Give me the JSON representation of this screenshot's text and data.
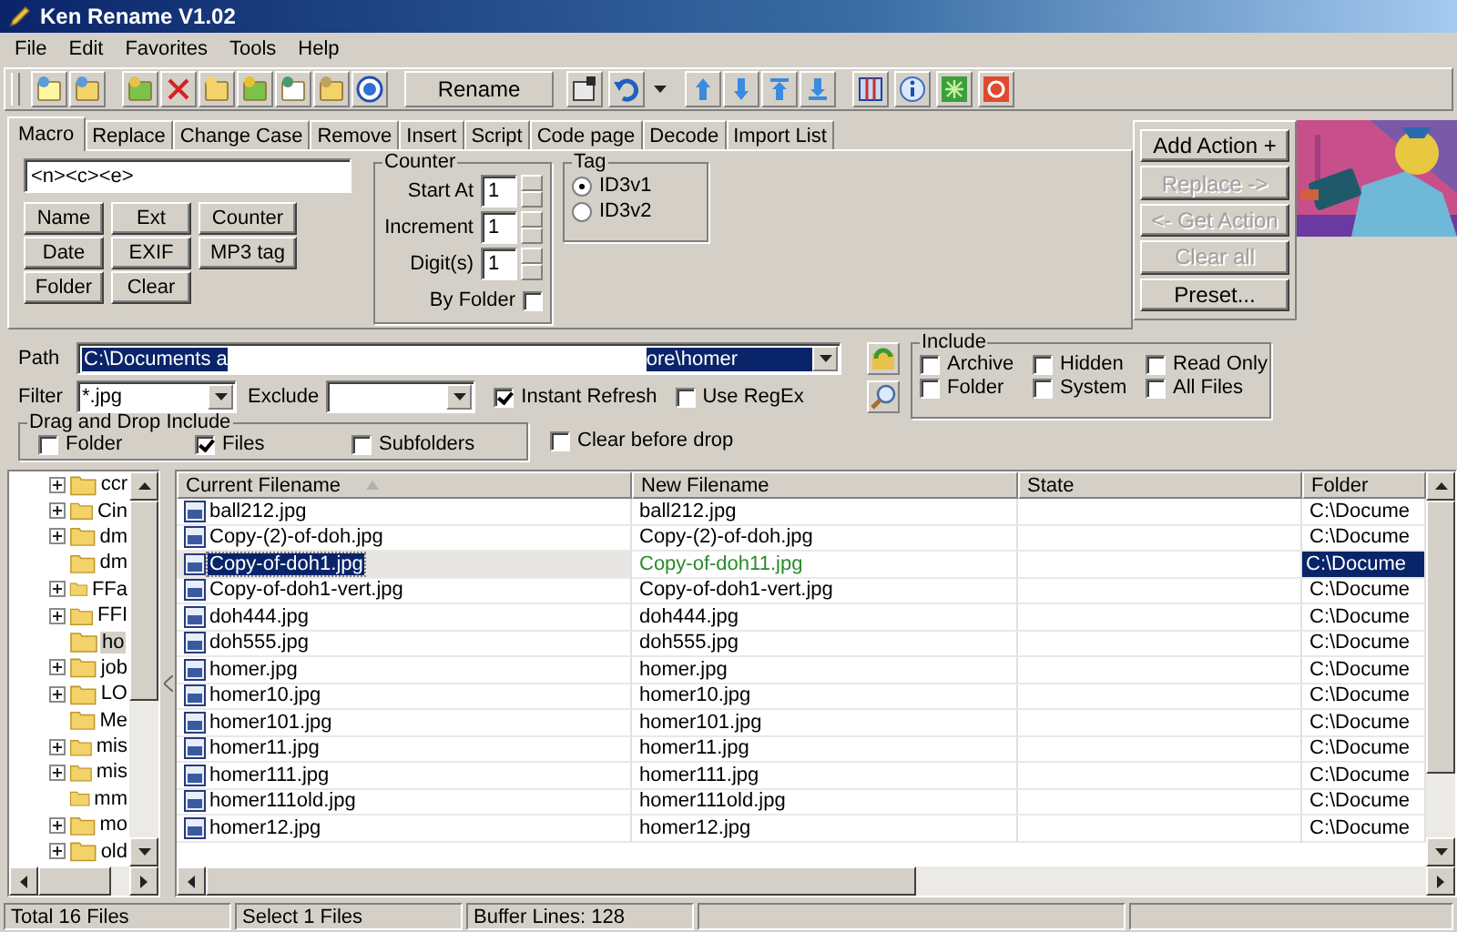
{
  "window": {
    "title": "Ken Rename V1.02"
  },
  "menu": [
    "File",
    "Edit",
    "Favorites",
    "Tools",
    "Help"
  ],
  "toolbar": {
    "rename_button": "Rename"
  },
  "tabs": [
    {
      "label": "Macro",
      "selected": true
    },
    {
      "label": "Replace",
      "selected": false
    },
    {
      "label": "Change Case",
      "selected": false
    },
    {
      "label": "Remove",
      "selected": false
    },
    {
      "label": "Insert",
      "selected": false
    },
    {
      "label": "Script",
      "selected": false
    },
    {
      "label": "Code page",
      "selected": false
    },
    {
      "label": "Decode",
      "selected": false
    },
    {
      "label": "Import List",
      "selected": false
    }
  ],
  "macro": {
    "value": "<n><c><e>",
    "buttons": [
      "Name",
      "Ext",
      "Counter",
      "Date",
      "EXIF",
      "MP3 tag",
      "Folder",
      "Clear"
    ]
  },
  "counter": {
    "title": "Counter",
    "fields": [
      {
        "label": "Start At",
        "value": "1"
      },
      {
        "label": "Increment",
        "value": "1"
      },
      {
        "label": "Digit(s)",
        "value": "1"
      }
    ],
    "by_folder": {
      "label": "By Folder",
      "checked": false
    }
  },
  "tag": {
    "title": "Tag",
    "options": [
      {
        "label": "ID3v1",
        "selected": true
      },
      {
        "label": "ID3v2",
        "selected": false
      }
    ]
  },
  "actions": [
    {
      "label": "Add Action +",
      "disabled": false
    },
    {
      "label": "Replace ->",
      "disabled": true
    },
    {
      "label": "<- Get Action",
      "disabled": true
    },
    {
      "label": "Clear all",
      "disabled": true
    },
    {
      "label": "Preset...",
      "disabled": false
    }
  ],
  "path": {
    "label": "Path",
    "value_start": "C:\\Documents a",
    "value_end": "ore\\homer"
  },
  "filter": {
    "label": "Filter",
    "value": "*.jpg"
  },
  "exclude": {
    "label": "Exclude"
  },
  "options": [
    {
      "label": "Instant Refresh",
      "checked": true
    },
    {
      "label": "Use RegEx",
      "checked": false
    }
  ],
  "drag_drop": {
    "title": "Drag and Drop Include",
    "items": [
      {
        "label": "Folder",
        "checked": false
      },
      {
        "label": "Files",
        "checked": true
      },
      {
        "label": "Subfolders",
        "checked": false
      }
    ]
  },
  "clear_before_drop": {
    "label": "Clear before drop",
    "checked": false
  },
  "include": {
    "title": "Include",
    "items": [
      {
        "label": "Archive",
        "checked": false
      },
      {
        "label": "Hidden",
        "checked": false
      },
      {
        "label": "Read Only",
        "checked": false
      },
      {
        "label": "Folder",
        "checked": false
      },
      {
        "label": "System",
        "checked": false
      },
      {
        "label": "All Files",
        "checked": false
      }
    ]
  },
  "tree": [
    {
      "label": "ccr",
      "expandable": true,
      "selected": false
    },
    {
      "label": "Cin",
      "expandable": true,
      "selected": false
    },
    {
      "label": "dm",
      "expandable": true,
      "selected": false
    },
    {
      "label": "dm",
      "expandable": false,
      "selected": false
    },
    {
      "label": "FFa",
      "expandable": true,
      "selected": false
    },
    {
      "label": "FFI",
      "expandable": true,
      "selected": false
    },
    {
      "label": "ho",
      "expandable": false,
      "selected": true
    },
    {
      "label": "job",
      "expandable": true,
      "selected": false
    },
    {
      "label": "LO",
      "expandable": true,
      "selected": false
    },
    {
      "label": "Me",
      "expandable": false,
      "selected": false
    },
    {
      "label": "mis",
      "expandable": true,
      "selected": false
    },
    {
      "label": "mis",
      "expandable": true,
      "selected": false
    },
    {
      "label": "mm",
      "expandable": false,
      "selected": false
    },
    {
      "label": "mo",
      "expandable": true,
      "selected": false
    },
    {
      "label": "old",
      "expandable": true,
      "selected": false
    }
  ],
  "table": {
    "columns": [
      "Current Filename",
      "New Filename",
      "State",
      "Folder"
    ],
    "rows": [
      {
        "current": "ball212.jpg",
        "new": "ball212.jpg",
        "changed": false,
        "folder": "C:\\Docume",
        "selected": false
      },
      {
        "current": "Copy-(2)-of-doh.jpg",
        "new": "Copy-(2)-of-doh.jpg",
        "changed": false,
        "folder": "C:\\Docume",
        "selected": false
      },
      {
        "current": "Copy-of-doh1.jpg",
        "new": "Copy-of-doh11.jpg",
        "changed": true,
        "folder": "C:\\Docume",
        "selected": true
      },
      {
        "current": "Copy-of-doh1-vert.jpg",
        "new": "Copy-of-doh1-vert.jpg",
        "changed": false,
        "folder": "C:\\Docume",
        "selected": false
      },
      {
        "current": "doh444.jpg",
        "new": "doh444.jpg",
        "changed": false,
        "folder": "C:\\Docume",
        "selected": false
      },
      {
        "current": "doh555.jpg",
        "new": "doh555.jpg",
        "changed": false,
        "folder": "C:\\Docume",
        "selected": false
      },
      {
        "current": "homer.jpg",
        "new": "homer.jpg",
        "changed": false,
        "folder": "C:\\Docume",
        "selected": false
      },
      {
        "current": "homer10.jpg",
        "new": "homer10.jpg",
        "changed": false,
        "folder": "C:\\Docume",
        "selected": false
      },
      {
        "current": "homer101.jpg",
        "new": "homer101.jpg",
        "changed": false,
        "folder": "C:\\Docume",
        "selected": false
      },
      {
        "current": "homer11.jpg",
        "new": "homer11.jpg",
        "changed": false,
        "folder": "C:\\Docume",
        "selected": false
      },
      {
        "current": "homer111.jpg",
        "new": "homer111.jpg",
        "changed": false,
        "folder": "C:\\Docume",
        "selected": false
      },
      {
        "current": "homer111old.jpg",
        "new": "homer111old.jpg",
        "changed": false,
        "folder": "C:\\Docume",
        "selected": false
      },
      {
        "current": "homer12.jpg",
        "new": "homer12.jpg",
        "changed": false,
        "folder": "C:\\Docume",
        "selected": false
      }
    ]
  },
  "status_bar": [
    "Total 16 Files",
    "Select 1 Files",
    "Buffer Lines: 128"
  ]
}
